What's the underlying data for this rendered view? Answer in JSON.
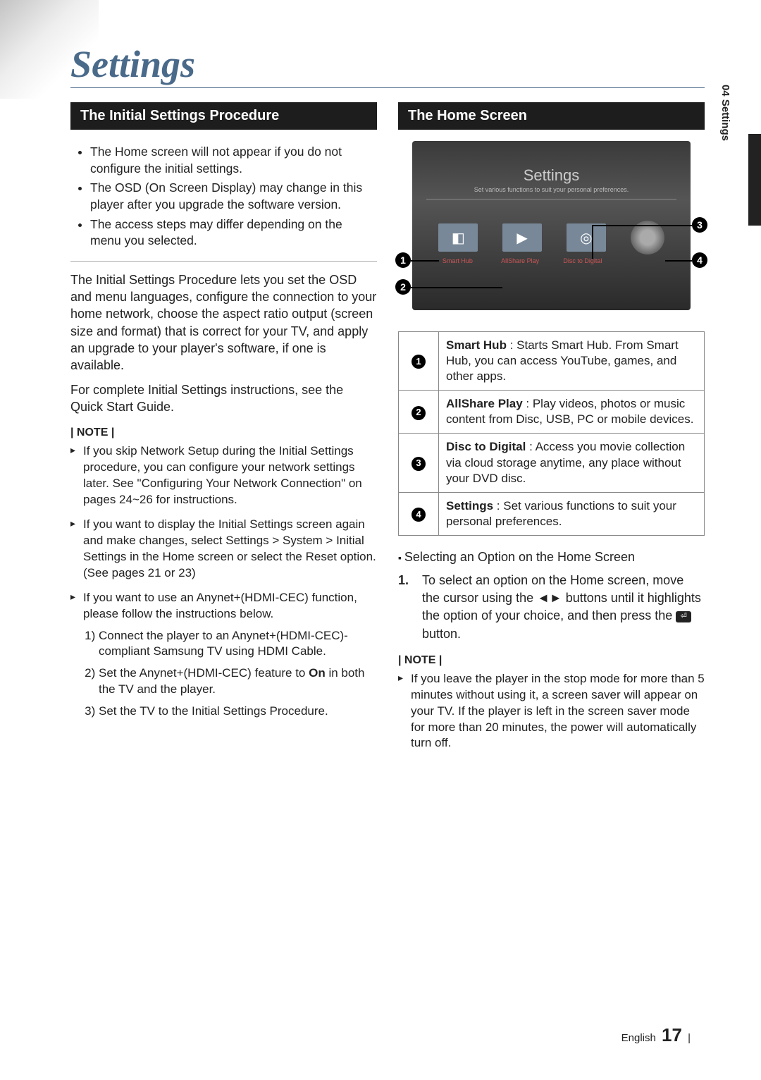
{
  "page_title": "Settings",
  "side_tab": "04   Settings",
  "left": {
    "heading": "The Initial Settings Procedure",
    "box_bullets": [
      "The Home screen will not appear if you do not configure the initial settings.",
      "The OSD (On Screen Display) may change in this player after you upgrade the software version.",
      "The access steps may differ depending on the menu you selected."
    ],
    "para1": "The Initial Settings Procedure lets you set the OSD and menu languages, configure the connection to your home network, choose the aspect ratio output (screen size and format) that is correct for your TV, and apply an upgrade to your player's software, if one is available.",
    "para2": "For complete Initial Settings instructions, see the Quick Start Guide.",
    "note_label": "| NOTE |",
    "notes": [
      "If you skip Network Setup during the Initial Settings procedure, you can configure your network settings later. See \"Configuring Your Network Connection\" on pages 24~26 for instructions.",
      "If you want to display the Initial Settings screen again and make changes, select Settings > System > Initial Settings in the Home screen or select the Reset option. (See pages 21 or 23)",
      "If you want to use an Anynet+(HDMI-CEC) function, please follow the instructions below."
    ],
    "anynet_steps_prefix_on": "On",
    "anynet_steps": [
      "Connect the player to an Anynet+(HDMI-CEC)-compliant Samsung TV using HDMI Cable.",
      "Set the Anynet+(HDMI-CEC) feature to On in both the TV and the player.",
      "Set the TV to the Initial Settings Procedure."
    ]
  },
  "right": {
    "heading": "The Home Screen",
    "screen": {
      "title": "Settings",
      "subtitle": "Set various functions to suit your personal preferences.",
      "icons": {
        "smart_hub": "Smart Hub",
        "allshare": "AllShare Play",
        "disc": "Disc to Digital"
      },
      "callouts": {
        "c1": "1",
        "c2": "2",
        "c3": "3",
        "c4": "4"
      }
    },
    "legend": [
      {
        "n": "1",
        "title": "Smart Hub",
        "desc": " : Starts Smart Hub. From Smart Hub, you can access YouTube, games, and other apps."
      },
      {
        "n": "2",
        "title": "AllShare Play",
        "desc": " : Play videos, photos or music content from Disc, USB, PC or mobile devices."
      },
      {
        "n": "3",
        "title": "Disc to Digital",
        "desc": " : Access you movie collection via cloud storage anytime, any place without your DVD disc."
      },
      {
        "n": "4",
        "title": "Settings",
        "desc": " : Set various functions to suit your personal preferences."
      }
    ],
    "sub_heading": "Selecting an Option on the Home Screen",
    "step": {
      "num": "1.",
      "text_a": "To select an option on the Home screen, move the cursor using the ◄► buttons until it highlights the option of your choice, and then press the ",
      "text_b": " button."
    },
    "note_label": "| NOTE |",
    "note": "If you leave the player in the stop mode for more than 5 minutes without using it, a screen saver will appear on your TV. If the player is left in the screen saver mode for more than 20 minutes, the power will automatically turn off."
  },
  "footer": {
    "lang": "English",
    "page": "17",
    "bar": "|"
  }
}
